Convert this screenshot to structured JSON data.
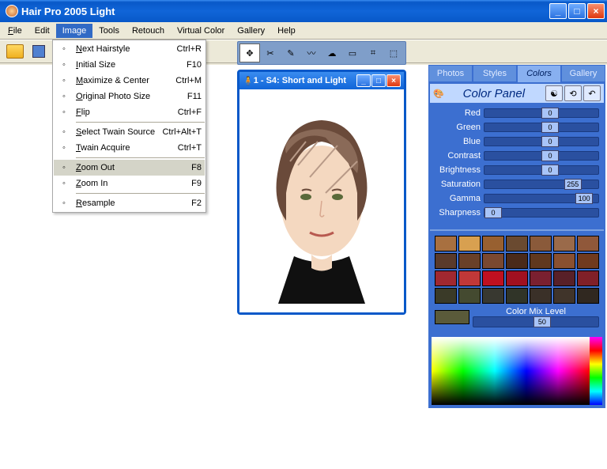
{
  "window": {
    "title": "Hair Pro 2005  Light"
  },
  "menubar": [
    "File",
    "Edit",
    "Image",
    "Tools",
    "Retouch",
    "Virtual Color",
    "Gallery",
    "Help"
  ],
  "dropdown": [
    {
      "label": "Next Hairstyle",
      "shortcut": "Ctrl+R"
    },
    {
      "label": "Initial Size",
      "shortcut": "F10"
    },
    {
      "label": "Maximize & Center",
      "shortcut": "Ctrl+M"
    },
    {
      "label": "Original Photo Size",
      "shortcut": "F11"
    },
    {
      "label": "Flip",
      "shortcut": "Ctrl+F"
    },
    {
      "sep": true
    },
    {
      "label": "Select Twain Source",
      "shortcut": "Ctrl+Alt+T"
    },
    {
      "label": "Twain Acquire",
      "shortcut": "Ctrl+T"
    },
    {
      "sep": true
    },
    {
      "label": "Zoom Out",
      "shortcut": "F8",
      "hl": true
    },
    {
      "label": "Zoom In",
      "shortcut": "F9"
    },
    {
      "sep": true
    },
    {
      "label": "Resample",
      "shortcut": "F2"
    }
  ],
  "canvas": {
    "title": "1 - S4: Short and Light"
  },
  "tabs": [
    "Photos",
    "Styles",
    "Colors",
    "Gallery"
  ],
  "color_panel": {
    "title": "Color Panel",
    "sliders": [
      {
        "name": "Red",
        "value": 0,
        "pos": 50
      },
      {
        "name": "Green",
        "value": 0,
        "pos": 50
      },
      {
        "name": "Blue",
        "value": 0,
        "pos": 50
      },
      {
        "name": "Contrast",
        "value": 0,
        "pos": 50
      },
      {
        "name": "Brightness",
        "value": 0,
        "pos": 50
      },
      {
        "name": "Saturation",
        "value": 255,
        "pos": 70
      },
      {
        "name": "Gamma",
        "value": 100,
        "pos": 80
      },
      {
        "name": "Sharpness",
        "value": 0,
        "pos": 0
      }
    ],
    "mix_label": "Color Mix Level",
    "mix_value": 50,
    "mix_color": "#5a5a3a",
    "swatches": [
      "#a87040",
      "#d8a050",
      "#986030",
      "#6a4a30",
      "#8a5a3a",
      "#9a6a4a",
      "#90583a",
      "#5a3a2a",
      "#6a4028",
      "#7a4830",
      "#4a2a1a",
      "#60381e",
      "#8a5030",
      "#703a1e",
      "#a02830",
      "#c03838",
      "#c01020",
      "#a01020",
      "#7a2030",
      "#582028",
      "#802028",
      "#3a3a28",
      "#444a30",
      "#383830",
      "#303428",
      "#3a3028",
      "#40342a",
      "#302820"
    ]
  }
}
